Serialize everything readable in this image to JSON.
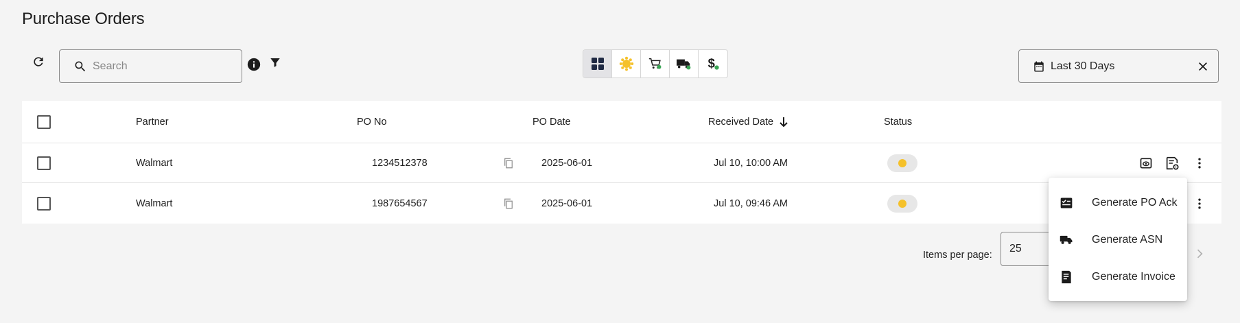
{
  "page": {
    "title": "Purchase Orders"
  },
  "toolbar": {
    "search_placeholder": "Search",
    "date_filter_label": "Last 30 Days"
  },
  "icons": {
    "refresh": "refresh-icon",
    "search": "search-icon",
    "info": "info-icon",
    "filter": "filter-icon",
    "calendar": "calendar-icon",
    "clear": "close-icon",
    "view_all": "grid-icon",
    "status_pending": "sun-icon",
    "orders": "cart-icon",
    "shipments": "truck-icon",
    "invoices": "dollar-icon"
  },
  "colors": {
    "status_pending": "#f5c12a",
    "accent_green": "#3aa655"
  },
  "table": {
    "columns": [
      "Partner",
      "PO No",
      "PO Date",
      "Received Date",
      "Status"
    ],
    "rows": [
      {
        "partner": "Walmart",
        "po_no": "1234512378",
        "po_date": "2025-06-01",
        "received": "Jul 10, 10:00 AM"
      },
      {
        "partner": "Walmart",
        "po_no": "1987654567",
        "po_date": "2025-06-01",
        "received": "Jul 10, 09:46 AM"
      }
    ]
  },
  "paginator": {
    "label": "Items per page:",
    "page_size": "25"
  },
  "menu": {
    "items": [
      {
        "label": "Generate PO Ack",
        "icon": "ack-icon"
      },
      {
        "label": "Generate ASN",
        "icon": "truck-icon"
      },
      {
        "label": "Generate Invoice",
        "icon": "invoice-icon"
      }
    ]
  }
}
